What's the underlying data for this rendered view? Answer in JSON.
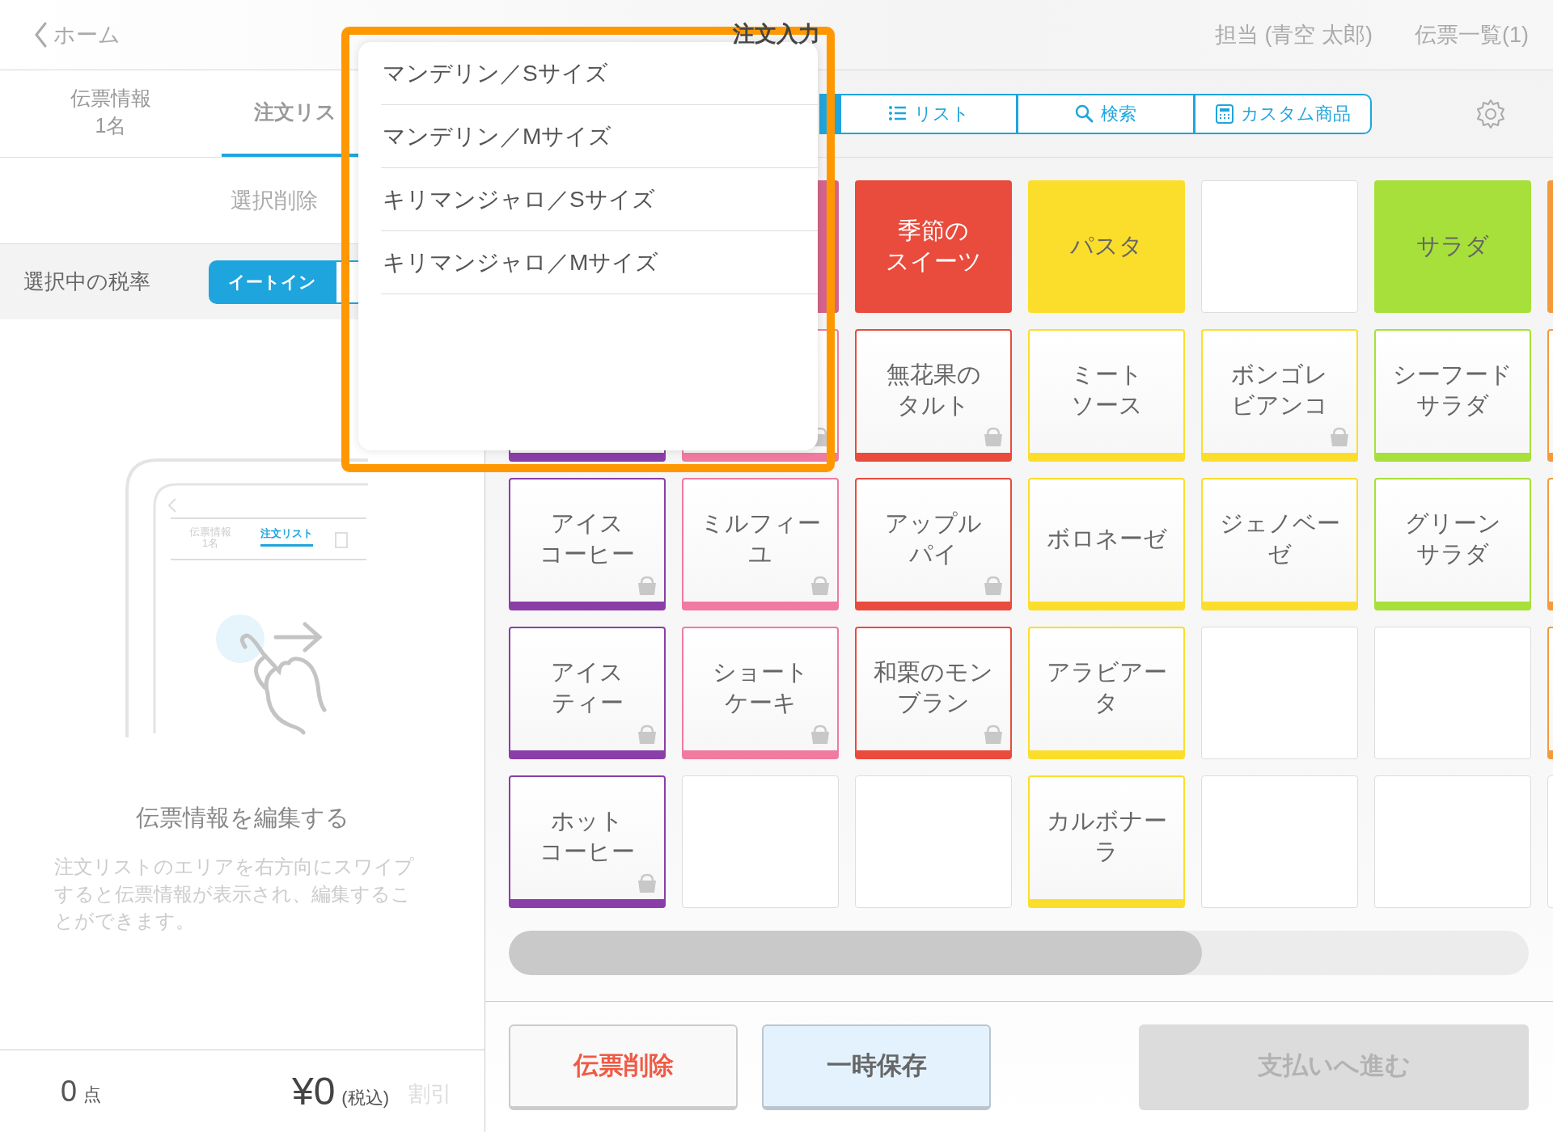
{
  "header": {
    "back": "ホーム",
    "title": "注文入力",
    "staff": "担当 (青空 太郎)",
    "slips": "伝票一覧(1)"
  },
  "left_tabs": [
    {
      "label": "伝票情報",
      "sub": "1名",
      "selected": false
    },
    {
      "label": "注文リス",
      "selected": true
    }
  ],
  "delete_selected": "選択削除",
  "tax": {
    "label": "選択中の税率",
    "options": [
      {
        "label": "イートイン",
        "selected": true
      },
      {
        "selected": false
      }
    ]
  },
  "guide": {
    "mini_tabs": [
      {
        "label": "伝票情報",
        "sub": "1名",
        "selected": false
      },
      {
        "label": "注文リスト",
        "selected": true
      }
    ],
    "title": "伝票情報を編集する",
    "text": "注文リストのエリアを右方向にスワイプすると伝票情報が表示され、編集することができます。"
  },
  "totals": {
    "count": "0",
    "count_unit": "点",
    "amount": "¥0",
    "tax_note": "(税込)",
    "discount": "割引"
  },
  "view_tabs": [
    {
      "selected": true
    },
    {
      "label": "リスト",
      "selected": false
    },
    {
      "label": "検索",
      "selected": false
    },
    {
      "label": "カスタム商品",
      "selected": false
    }
  ],
  "grid": [
    [
      {
        "kind": "category",
        "color": "#d4658a"
      },
      {
        "kind": "category",
        "color": "#e94b3c",
        "lines": [
          "季節の",
          "スイーツ"
        ]
      },
      {
        "kind": "category",
        "color": "#fbde2b",
        "lines": [
          "パスタ"
        ]
      },
      {
        "kind": "empty"
      },
      {
        "kind": "category",
        "color": "#a7e03a",
        "lines": [
          "サラダ"
        ]
      },
      {
        "kind": "category",
        "color": "#f59a3a"
      }
    ],
    [
      {
        "kind": "item",
        "color": "#8a3ea8"
      },
      {
        "kind": "item",
        "color": "#f07aa0",
        "bag": true
      },
      {
        "kind": "item",
        "color": "#e94b3c",
        "lines": [
          "無花果の",
          "タルト"
        ],
        "bag": true
      },
      {
        "kind": "item",
        "color": "#fbde2b",
        "lines": [
          "ミート",
          "ソース"
        ],
        "bag": false
      },
      {
        "kind": "item",
        "color": "#fbde2b",
        "lines": [
          "ボンゴレ",
          "ビアンコ"
        ],
        "bag": true
      },
      {
        "kind": "item",
        "color": "#a7e03a",
        "lines": [
          "シーフード",
          "サラダ"
        ],
        "bag": false
      },
      {
        "kind": "item",
        "color": "#f59a3a"
      }
    ],
    [
      {
        "kind": "item",
        "color": "#8a3ea8",
        "lines": [
          "アイス",
          "コーヒー"
        ],
        "bag": true
      },
      {
        "kind": "item",
        "color": "#f07aa0",
        "lines": [
          "ミルフィー",
          "ユ"
        ],
        "bag": true
      },
      {
        "kind": "item",
        "color": "#e94b3c",
        "lines": [
          "アップル",
          "パイ"
        ],
        "bag": true
      },
      {
        "kind": "item",
        "color": "#fbde2b",
        "lines": [
          "ボロネーゼ"
        ],
        "bag": false
      },
      {
        "kind": "item",
        "color": "#fbde2b",
        "lines": [
          "ジェノベー",
          "ゼ"
        ],
        "bag": false
      },
      {
        "kind": "item",
        "color": "#a7e03a",
        "lines": [
          "グリーン",
          "サラダ"
        ],
        "bag": false
      },
      {
        "kind": "item",
        "color": "#f59a3a"
      }
    ],
    [
      {
        "kind": "item",
        "color": "#8a3ea8",
        "lines": [
          "アイス",
          "ティー"
        ],
        "bag": true
      },
      {
        "kind": "item",
        "color": "#f07aa0",
        "lines": [
          "ショート",
          "ケーキ"
        ],
        "bag": true
      },
      {
        "kind": "item",
        "color": "#e94b3c",
        "lines": [
          "和栗のモン",
          "ブラン"
        ],
        "bag": true
      },
      {
        "kind": "item",
        "color": "#fbde2b",
        "lines": [
          "アラビアー",
          "タ"
        ],
        "bag": false
      },
      {
        "kind": "empty"
      },
      {
        "kind": "empty"
      },
      {
        "kind": "item",
        "color": "#f59a3a"
      }
    ],
    [
      {
        "kind": "item",
        "color": "#8a3ea8",
        "lines": [
          "ホット",
          "コーヒー"
        ],
        "bag": true
      },
      {
        "kind": "empty"
      },
      {
        "kind": "empty"
      },
      {
        "kind": "item",
        "color": "#fbde2b",
        "lines": [
          "カルボナー",
          "ラ"
        ],
        "bag": false
      },
      {
        "kind": "empty"
      },
      {
        "kind": "empty"
      },
      {
        "kind": "empty"
      }
    ]
  ],
  "actions": [
    {
      "label": "伝票削除",
      "kind": "delete",
      "disabled": false
    },
    {
      "label": "一時保存",
      "kind": "save",
      "disabled": false
    },
    {
      "label": "支払いへ進む",
      "kind": "pay",
      "disabled": true
    }
  ],
  "popup": {
    "options": [
      "マンデリン／Sサイズ",
      "マンデリン／Mサイズ",
      "キリマンジャロ／Sサイズ",
      "キリマンジャロ／Mサイズ"
    ]
  }
}
